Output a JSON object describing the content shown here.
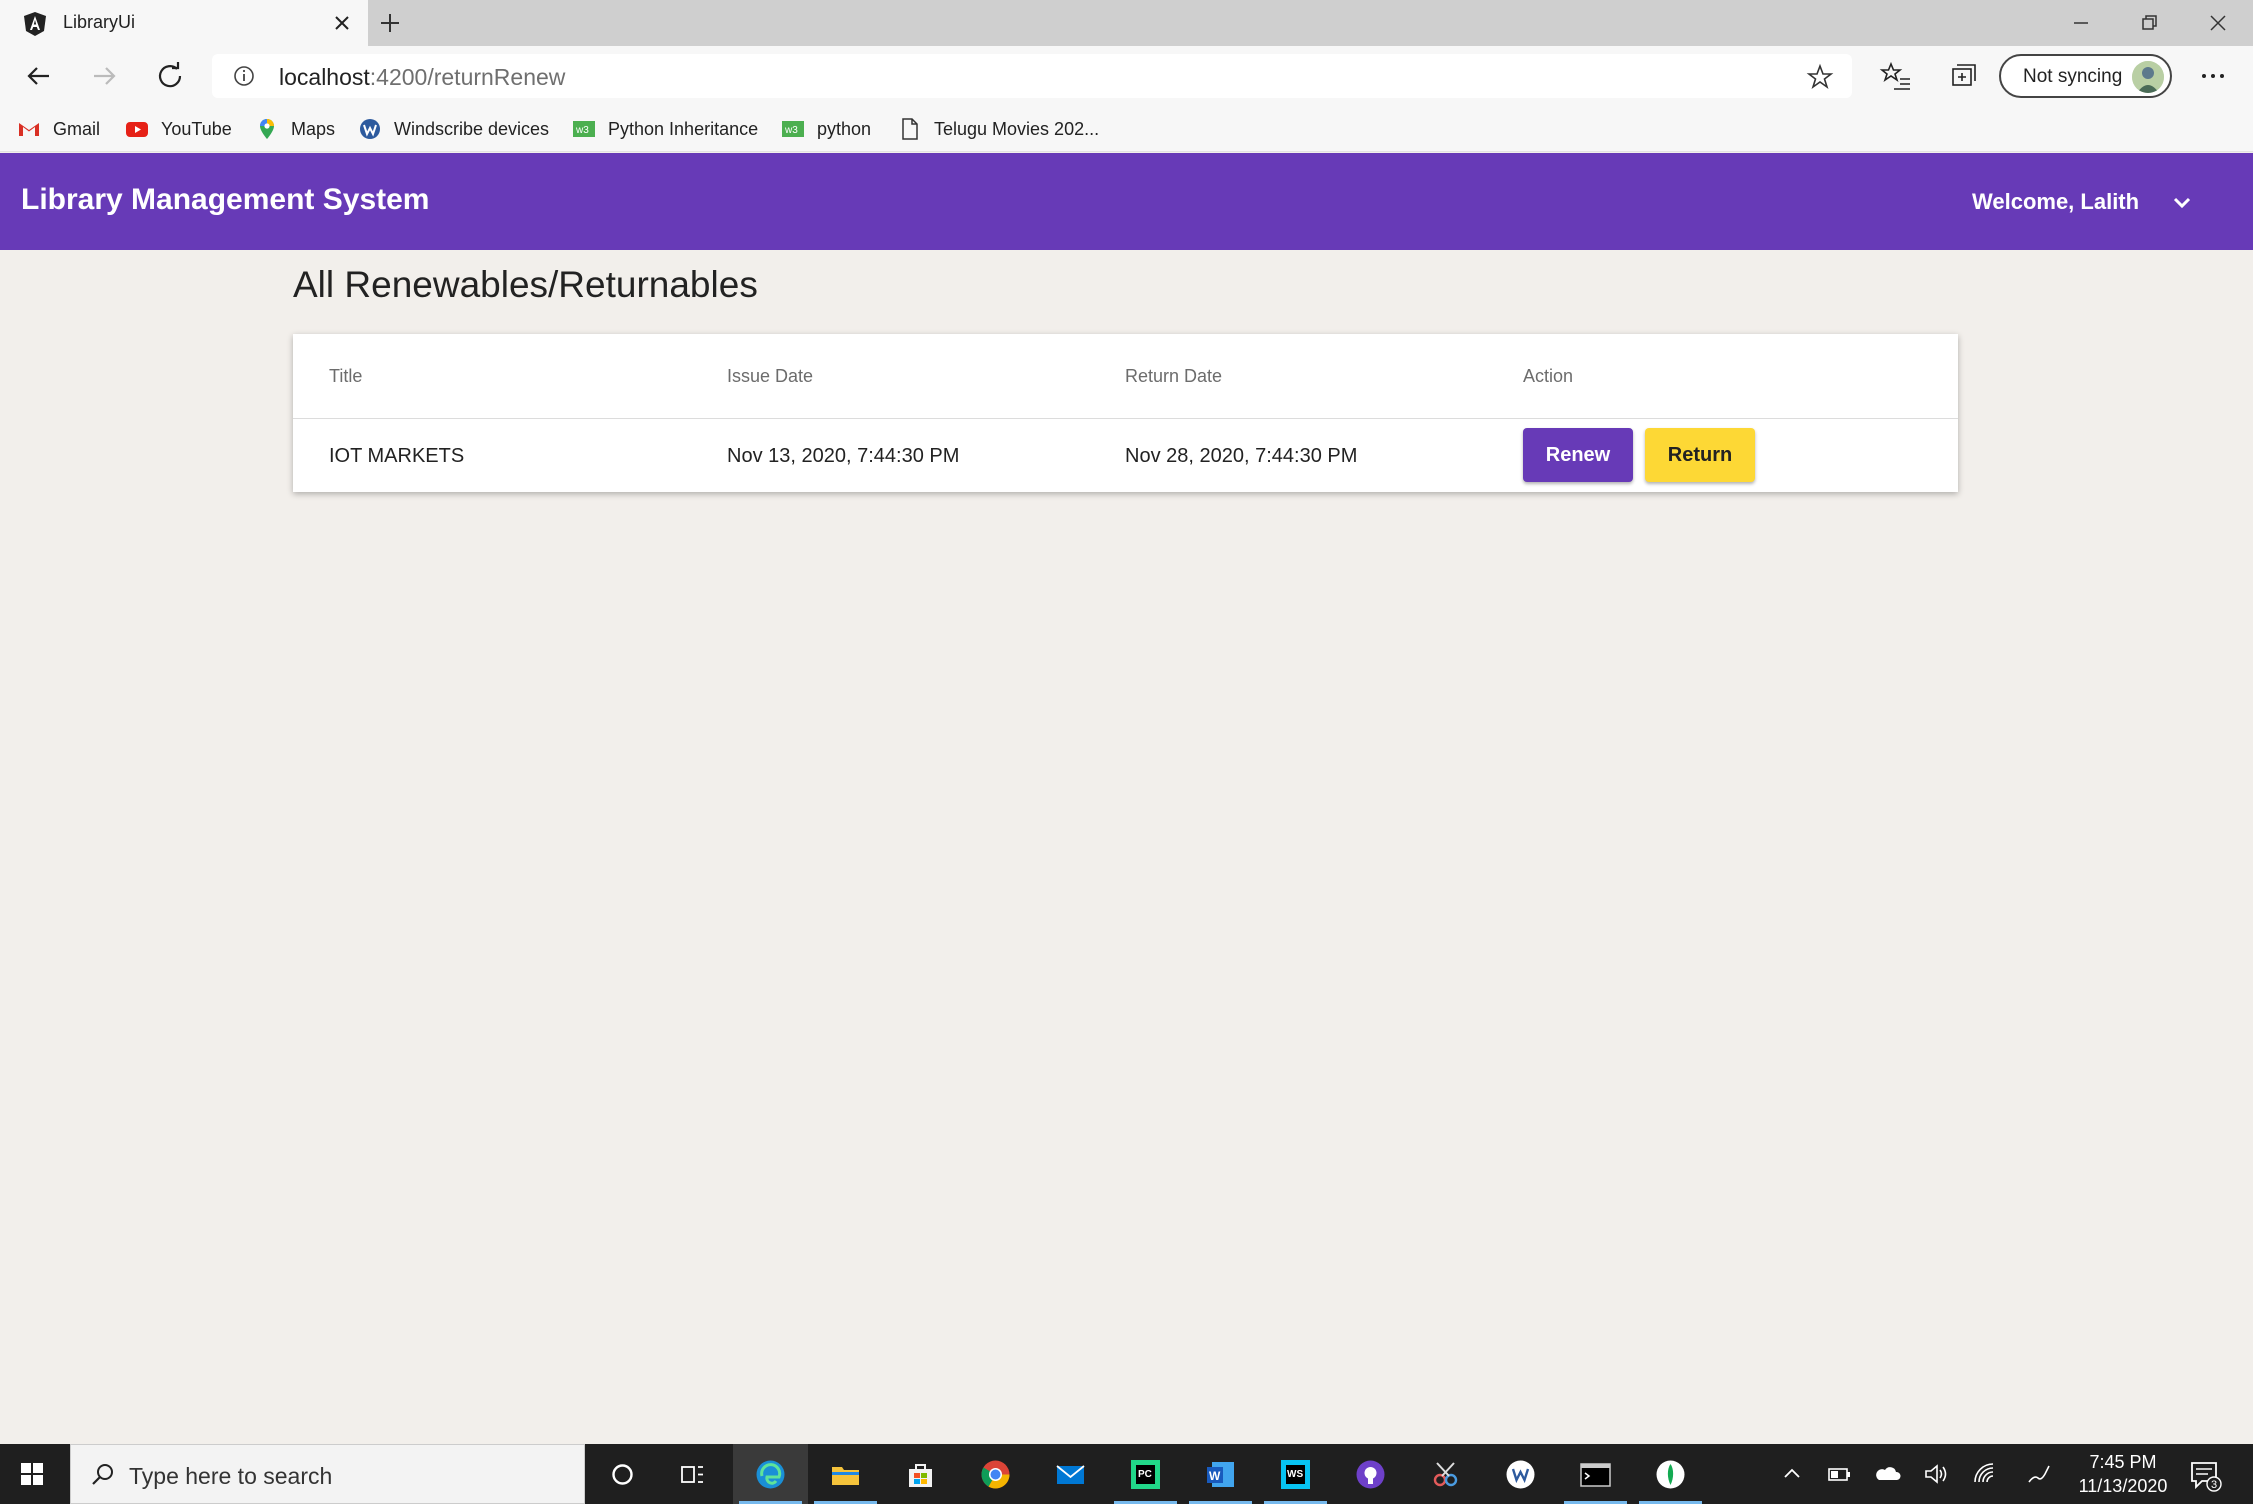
{
  "browser": {
    "tab_title": "LibraryUi",
    "url_host": "localhost",
    "url_path": ":4200/returnRenew",
    "sync_label": "Not syncing",
    "bookmarks": [
      {
        "label": "Gmail",
        "icon": "gmail-icon"
      },
      {
        "label": "YouTube",
        "icon": "youtube-icon"
      },
      {
        "label": "Maps",
        "icon": "maps-icon"
      },
      {
        "label": "Windscribe devices",
        "icon": "windscribe-icon"
      },
      {
        "label": "Python Inheritance",
        "icon": "w3schools-icon"
      },
      {
        "label": "python",
        "icon": "w3schools-icon"
      },
      {
        "label": "Telugu Movies 202...",
        "icon": "page-icon"
      }
    ]
  },
  "app": {
    "title": "Library Management System",
    "welcome": "Welcome, Lalith",
    "accent_color": "#673ab7",
    "return_color": "#fdd835"
  },
  "page": {
    "heading": "All Renewables/Returnables",
    "columns": [
      "Title",
      "Issue Date",
      "Return Date",
      "Action"
    ],
    "rows": [
      {
        "title": "IOT MARKETS",
        "issue_date": "Nov 13, 2020, 7:44:30 PM",
        "return_date": "Nov 28, 2020, 7:44:30 PM",
        "renew_label": "Renew",
        "return_label": "Return"
      }
    ]
  },
  "taskbar": {
    "search_placeholder": "Type here to search",
    "time": "7:45 PM",
    "date": "11/13/2020",
    "notification_count": "3",
    "apps": [
      "cortana-icon",
      "task-view-icon",
      "edge-icon",
      "file-explorer-icon",
      "store-icon",
      "chrome-icon",
      "mail-icon",
      "pycharm-icon",
      "word-icon",
      "webstorm-icon",
      "github-desktop-icon",
      "snip-icon",
      "windscribe-icon",
      "terminal-icon",
      "mongodb-compass-icon"
    ]
  }
}
